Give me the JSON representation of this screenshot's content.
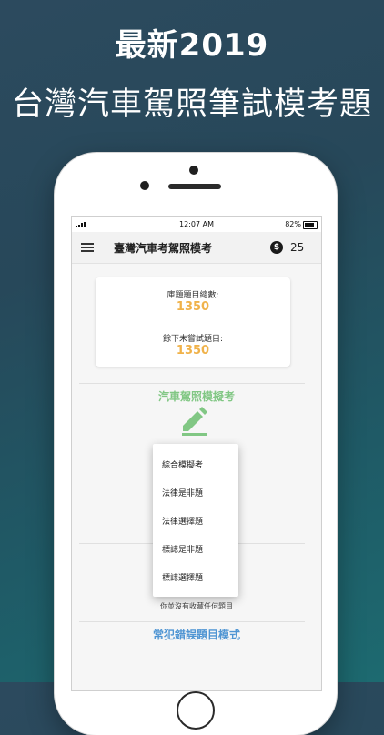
{
  "promo": {
    "line1": "最新2019",
    "line2": "台灣汽車駕照筆試模考題"
  },
  "status_bar": {
    "time": "12:07 AM",
    "battery": "82%"
  },
  "app_bar": {
    "title": "臺灣汽車考駕照模考",
    "coin_symbol": "$",
    "coin_count": "25"
  },
  "stats": {
    "total_label": "庫題題目總數:",
    "total_value": "1350",
    "remaining_label": "餘下未嘗試題目:",
    "remaining_value": "1350"
  },
  "exam_section": {
    "title": "汽車駕照模擬考",
    "icon": "pencil-icon",
    "accent": "#81c784"
  },
  "dropdown": {
    "items": [
      "綜合模擬考",
      "法律是非題",
      "法律選擇題",
      "標誌是非題",
      "標誌選擇題"
    ]
  },
  "favorites": {
    "empty_hint": "你並沒有收藏任何題目"
  },
  "mistakes": {
    "title": "常犯錯誤題目模式",
    "accent": "#4f95d3"
  },
  "colors": {
    "value_accent": "#f0b24a"
  }
}
